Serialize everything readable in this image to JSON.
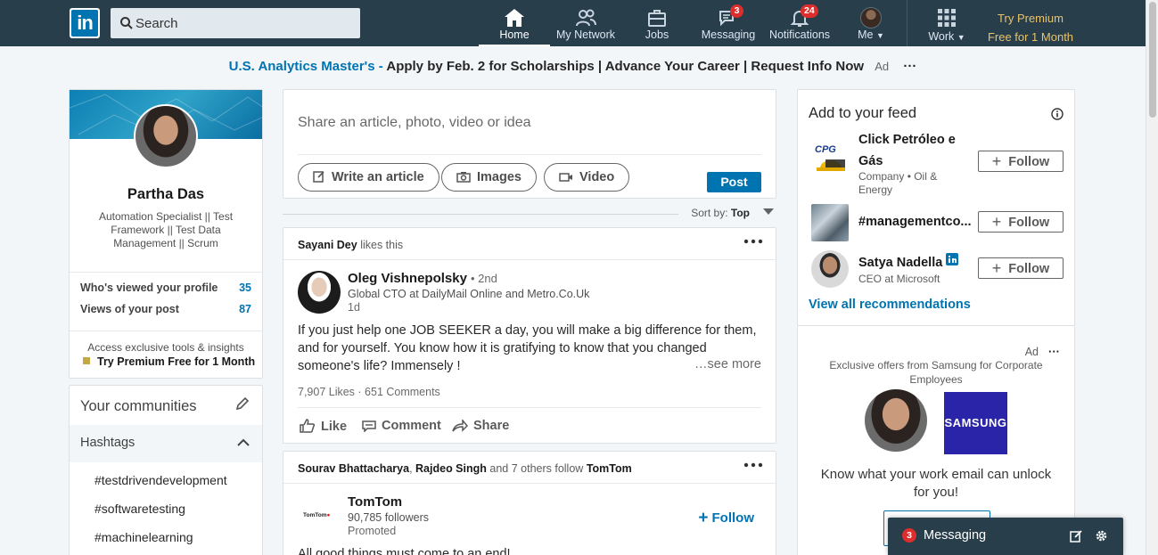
{
  "nav": {
    "logo_text": "in",
    "search_placeholder": "Search",
    "items": [
      {
        "label": "Home",
        "badge": ""
      },
      {
        "label": "My Network",
        "badge": ""
      },
      {
        "label": "Jobs",
        "badge": ""
      },
      {
        "label": "Messaging",
        "badge": "3"
      },
      {
        "label": "Notifications",
        "badge": "24"
      },
      {
        "label": "Me",
        "badge": ""
      },
      {
        "label": "Work",
        "badge": ""
      }
    ],
    "premium_line1": "Try Premium",
    "premium_line2": "Free for 1 Month"
  },
  "adline": {
    "brand": "U.S. Analytics Master's -",
    "text": "Apply by Feb. 2 for Scholarships | Advance Your Career | Request Info Now",
    "ad": "Ad",
    "dots": "···"
  },
  "profile": {
    "name": "Partha Das",
    "headline": "Automation Specialist || Test Framework || Test Data Management || Scrum",
    "stats": [
      {
        "label": "Who's viewed your profile",
        "value": "35"
      },
      {
        "label": "Views of your post",
        "value": "87"
      }
    ],
    "access": "Access exclusive tools & insights",
    "try_premium": "Try Premium Free for 1 Month"
  },
  "communities": {
    "title": "Your communities",
    "hashtags_title": "Hashtags",
    "hashtags": [
      "#testdrivendevelopment",
      "#softwaretesting",
      "#machinelearning"
    ]
  },
  "share": {
    "placeholder": "Share an article, photo, video or idea",
    "write": "Write an article",
    "images": "Images",
    "video": "Video",
    "post": "Post"
  },
  "sort": {
    "label": "Sort by:",
    "value": "Top"
  },
  "post1": {
    "ctx_name": "Sayani Dey",
    "ctx_rest": "likes this",
    "author": "Oleg Vishnepolsky",
    "degree": "• 2nd",
    "title": "Global CTO at DailyMail Online and Metro.Co.Uk",
    "time": "1d",
    "body": "If you just help one JOB SEEKER a day, you will make a big difference for them, and for yourself. You know how it is gratifying to know that you changed someone's life? Immensely !",
    "see_more": "…see more",
    "counts": "7,907 Likes · 651 Comments",
    "like": "Like",
    "comment": "Comment",
    "share": "Share"
  },
  "post2": {
    "ctx_a": "Sourav Bhattacharya",
    "ctx_comma": ",",
    "ctx_b": "Rajdeo Singh",
    "ctx_mid": "and 7 others follow",
    "ctx_c": "TomTom",
    "company": "TomTom",
    "logo_text": "TomTom",
    "followers": "90,785 followers",
    "promoted": "Promoted",
    "follow": "Follow",
    "body": "All good things must come to an end!"
  },
  "feed": {
    "title": "Add to your feed",
    "recs": [
      {
        "name": "Click Petróleo e Gás",
        "sub": "Company • Oil & Energy",
        "logo_text": "CPG"
      },
      {
        "name": "#managementco...",
        "sub": ""
      },
      {
        "name": "Satya Nadella",
        "sub": "CEO at Microsoft"
      }
    ],
    "follow": "Follow",
    "view_all": "View all recommendations"
  },
  "ad": {
    "label": "Ad",
    "dots": "···",
    "offer": "Exclusive offers from Samsung for Corporate Employees",
    "brand": "SAMSUNG",
    "tagline": "Know what your work email can unlock for you!"
  },
  "messaging_dock": {
    "badge": "3",
    "label": "Messaging"
  },
  "colors": {
    "nav_bg": "#283e4a",
    "link_blue": "#0073b1",
    "premium_gold": "#e7c36d",
    "badge_red": "#dd2d2d"
  }
}
